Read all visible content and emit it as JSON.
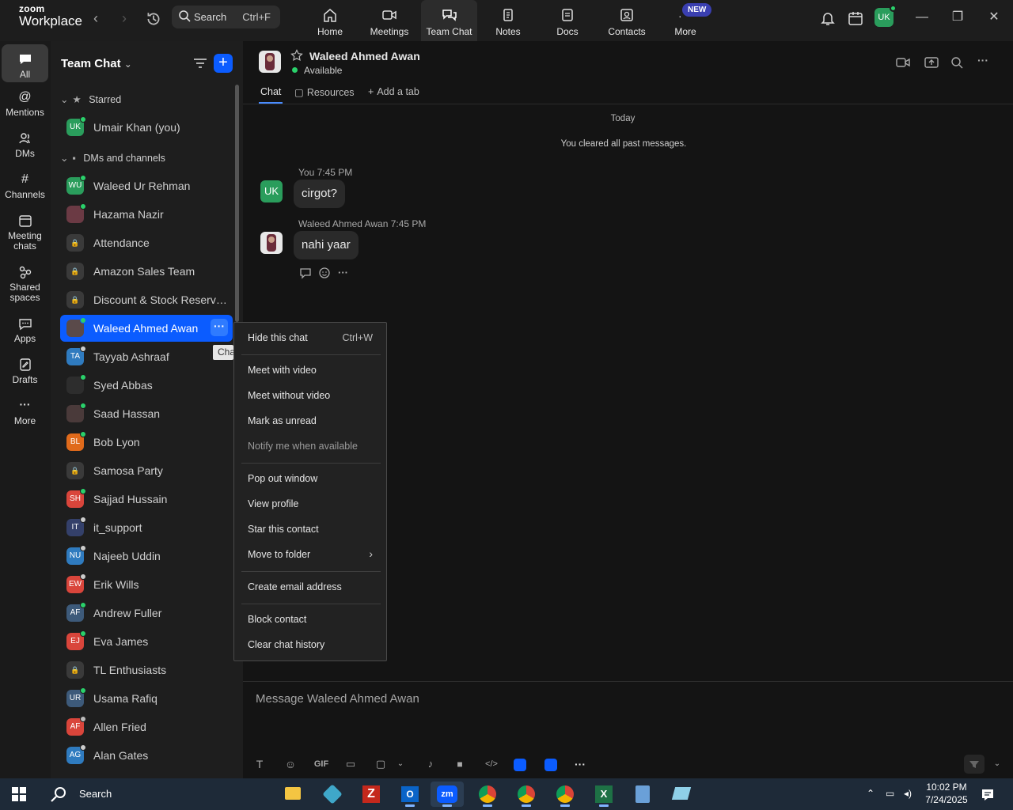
{
  "app": {
    "logo_small": "zoom",
    "logo_big": "Workplace"
  },
  "topbar": {
    "search_label": "Search",
    "search_shortcut": "Ctrl+F",
    "tabs": [
      {
        "label": "Home",
        "icon": "home-icon"
      },
      {
        "label": "Meetings",
        "icon": "video-camera-icon"
      },
      {
        "label": "Team Chat",
        "icon": "chat-bubbles-icon"
      },
      {
        "label": "Notes",
        "icon": "notes-icon"
      },
      {
        "label": "Docs",
        "icon": "docs-icon"
      },
      {
        "label": "Contacts",
        "icon": "contacts-icon"
      },
      {
        "label": "More",
        "icon": "more-dots-icon"
      }
    ],
    "new_badge": "NEW",
    "user_initials": "UK",
    "active_tab": "Team Chat"
  },
  "rail": {
    "items": [
      {
        "label": "All",
        "icon": "chat-bubble-icon"
      },
      {
        "label": "Mentions",
        "icon": "at-icon"
      },
      {
        "label": "DMs",
        "icon": "people-icon"
      },
      {
        "label": "Channels",
        "icon": "hash-icon"
      },
      {
        "label": "Meeting chats",
        "icon": "calendar-icon"
      },
      {
        "label": "Shared spaces",
        "icon": "shared-spaces-icon"
      },
      {
        "label": "Apps",
        "icon": "apps-icon"
      },
      {
        "label": "Drafts",
        "icon": "drafts-icon"
      },
      {
        "label": "More",
        "icon": "more-dots-icon"
      }
    ]
  },
  "sidebar": {
    "title": "Team Chat",
    "sections": {
      "starred": "Starred",
      "dms": "DMs and channels"
    },
    "starred": [
      {
        "initials": "UK",
        "name": "Umair Khan (you)",
        "color": "#2a9d5c",
        "status": "online"
      }
    ],
    "items": [
      {
        "initials": "WU",
        "name": "Waleed Ur Rehman",
        "color": "#2a9d5c",
        "status": "online"
      },
      {
        "initials": "",
        "name": "Hazama Nazir",
        "color": "#6b3a44",
        "status": "online"
      },
      {
        "initials": "🔒",
        "name": "Attendance",
        "color": "#3a3a3a",
        "status": ""
      },
      {
        "initials": "🔒",
        "name": "Amazon Sales Team",
        "color": "#3a3a3a",
        "status": ""
      },
      {
        "initials": "🔒",
        "name": "Discount & Stock Reservati...",
        "color": "#3a3a3a",
        "status": ""
      },
      {
        "initials": "",
        "name": "Waleed Ahmed Awan",
        "color": "#5a4a4a",
        "status": "online",
        "selected": true
      },
      {
        "initials": "TA",
        "name": "Tayyab Ashraaf",
        "color": "#2f7bbf",
        "status": "away"
      },
      {
        "initials": "",
        "name": "Syed Abbas",
        "color": "#2d2d2d",
        "status": "online"
      },
      {
        "initials": "",
        "name": "Saad Hassan",
        "color": "#4a3a3a",
        "status": "online"
      },
      {
        "initials": "BL",
        "name": "Bob Lyon",
        "color": "#e06a1b",
        "status": "online"
      },
      {
        "initials": "🔒",
        "name": "Samosa Party",
        "color": "#3a3a3a",
        "status": ""
      },
      {
        "initials": "SH",
        "name": "Sajjad Hussain",
        "color": "#d9453b",
        "status": "online"
      },
      {
        "initials": "IT",
        "name": "it_support",
        "color": "#34406a",
        "status": "away"
      },
      {
        "initials": "NU",
        "name": "Najeeb Uddin",
        "color": "#2f7bbf",
        "status": "away"
      },
      {
        "initials": "EW",
        "name": "Erik Wills",
        "color": "#d9453b",
        "status": "away"
      },
      {
        "initials": "AF",
        "name": "Andrew Fuller",
        "color": "#3d5a7a",
        "status": "online"
      },
      {
        "initials": "EJ",
        "name": "Eva James",
        "color": "#d9453b",
        "status": "online"
      },
      {
        "initials": "🔒",
        "name": "TL Enthusiasts",
        "color": "#3a3a3a",
        "status": ""
      },
      {
        "initials": "UR",
        "name": "Usama Rafiq",
        "color": "#3d5a7a",
        "status": "online"
      },
      {
        "initials": "AF",
        "name": "Allen Fried",
        "color": "#d9453b",
        "status": "offline"
      },
      {
        "initials": "AG",
        "name": "Alan Gates",
        "color": "#2f7bbf",
        "status": "away"
      }
    ],
    "tooltip": "Cha"
  },
  "chat": {
    "contact_name": "Waleed Ahmed Awan",
    "status": "Available",
    "tabs": {
      "chat": "Chat",
      "resources": "Resources",
      "add": "Add a tab"
    },
    "day_label": "Today",
    "cleared_notice": "You cleared all past messages.",
    "messages": [
      {
        "meta": "You 7:45 PM",
        "text": "cirgot?",
        "initials": "UK"
      },
      {
        "meta": "Waleed Ahmed Awan 7:45 PM",
        "text": "nahi yaar",
        "initials": ""
      }
    ],
    "composer_placeholder": "Message Waleed Ahmed Awan",
    "gif_label": "GIF"
  },
  "context_menu": {
    "items": [
      {
        "label": "Hide this chat",
        "shortcut": "Ctrl+W"
      },
      {
        "label": "Meet with video"
      },
      {
        "label": "Meet without video"
      },
      {
        "label": "Mark as unread"
      },
      {
        "label": "Notify me when available",
        "disabled": true
      },
      {
        "label": "Pop out window"
      },
      {
        "label": "View profile"
      },
      {
        "label": "Star this contact"
      },
      {
        "label": "Move to folder",
        "submenu": true
      },
      {
        "label": "Create email address"
      },
      {
        "label": "Block contact"
      },
      {
        "label": "Clear chat history"
      }
    ]
  },
  "taskbar": {
    "search_label": "Search",
    "time": "10:02 PM",
    "date": "7/24/2025",
    "zoom_label": "zm"
  }
}
